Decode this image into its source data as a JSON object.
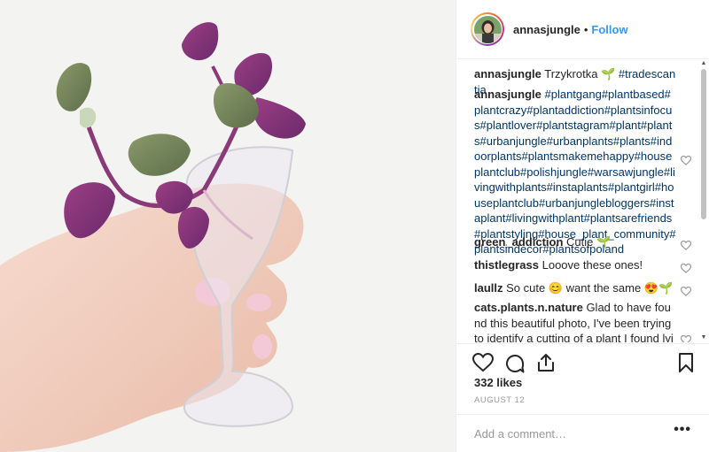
{
  "post": {
    "username": "annasjungle",
    "separator": "•",
    "follow_label": "Follow",
    "likes": "332 likes",
    "date": "AUGUST 12",
    "comment_placeholder": "Add a comment…",
    "more_label": "•••"
  },
  "comments": [
    {
      "user": "annasjungle",
      "text": "Trzykrotka 🌱",
      "tags": "#tradescantia",
      "heart": false
    },
    {
      "user": "annasjungle",
      "text": "",
      "tags": "#plantgang#plantbased#plantcrazy#plantaddiction#plantsinfocus#plantlover#plantstagram#plant#plants#urbanjungle#urbanplants#plants#indoorplants#plantsmakemehappy#houseplantclub#polishjungle#warsawjungle#livingwithplants#instaplants#plantgirl#houseplantclub#urbanjunglebloggers#instaplant#livingwithplant#plantsarefriends#plantstyling#house_plant_community#plantsindecor#plantsofpoland",
      "heart": true
    },
    {
      "user": "green_addiction",
      "text": "Cutie 🌱",
      "tags": "",
      "heart": true
    },
    {
      "user": "thistlegrass",
      "text": "Looove these ones!",
      "tags": "",
      "heart": true
    },
    {
      "user": "laullz",
      "text": "So cute 😊 want the same 😍🌱",
      "tags": "",
      "heart": true
    },
    {
      "user": "cats.plants.n.nature",
      "text": "Glad to have found this beautiful photo, I've been trying to identify a cutting of a plant I found lying around and saved and now",
      "tags": "",
      "heart": true
    }
  ],
  "icons": {
    "like": "heart-icon",
    "comment": "comment-icon",
    "share": "share-icon",
    "save": "bookmark-icon"
  },
  "colors": {
    "link": "#3897f0",
    "hashtag": "#003569",
    "muted": "#999999",
    "text": "#262626"
  }
}
